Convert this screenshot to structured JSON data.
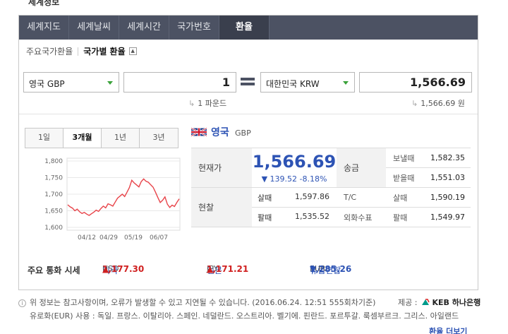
{
  "page": {
    "top_cut_title": "세계정보"
  },
  "tabs": [
    "세계지도",
    "세계날씨",
    "세계시간",
    "국가번호",
    "환율"
  ],
  "subnav": {
    "item1": "주요국가환율",
    "item2": "국가별 환율"
  },
  "converter": {
    "from_currency": "영국 GBP",
    "from_amount": "1",
    "to_currency": "대한민국 KRW",
    "to_amount": "1,566.69",
    "from_unit_text": "1 파운드",
    "to_unit_text": "1,566.69 원"
  },
  "period_tabs": [
    "1일",
    "3개월",
    "1년",
    "3년"
  ],
  "chart_data": {
    "type": "line",
    "x": [
      "04/12",
      "04/29",
      "05/19",
      "06/07"
    ],
    "series": [
      {
        "values": [
          1668,
          1662,
          1658,
          1650,
          1655,
          1647,
          1642,
          1645,
          1640,
          1636,
          1641,
          1646,
          1652,
          1648,
          1657,
          1664,
          1659,
          1671,
          1668,
          1664,
          1676,
          1688,
          1694,
          1700,
          1693,
          1706,
          1720,
          1742,
          1734,
          1728,
          1722,
          1738,
          1746,
          1739,
          1736,
          1728,
          1721,
          1706,
          1690,
          1675,
          1682,
          1692,
          1670,
          1660,
          1667,
          1663,
          1675,
          1686
        ]
      }
    ],
    "yticks": [
      "1,800",
      "1,750",
      "1,700",
      "1,650",
      "1,600"
    ],
    "ylim": [
      1600,
      1800
    ],
    "color": "#e8444a",
    "grid": true
  },
  "currency": {
    "name": "영국",
    "code": "GBP"
  },
  "rates": {
    "current_label": "현재가",
    "current_value": "1,566.69",
    "change_text": "▼ 139.52 -8.18%",
    "remit_label": "송금",
    "send_label": "보낼때",
    "send_value": "1,582.35",
    "receive_label": "받을때",
    "receive_value": "1,551.03",
    "cash_label": "현찰",
    "cash_buy_label": "살때",
    "cash_buy_value": "1,597.86",
    "cash_sell_label": "팔때",
    "cash_sell_value": "1,535.52",
    "tc_label": "T/C",
    "tc_buy_label": "살때",
    "tc_buy_value": "1,590.19",
    "check_label": "외화수표",
    "check_sell_label": "팔때",
    "check_sell_value": "1,549.97"
  },
  "major": {
    "label": "주요 통화 시세",
    "items": [
      {
        "name": "미국",
        "code": "USD",
        "value": "1,177.30",
        "dir": "▲"
      },
      {
        "name": "일본",
        "code": "JPY",
        "value": "1,171.21",
        "dir": "▲"
      },
      {
        "name": "유럽연합",
        "code": "EUR",
        "value": "1,285.26",
        "dir": "▼"
      }
    ]
  },
  "notice": {
    "line1": "위 정보는 참고사항이며, 오류가 발생할 수 있고 지연될 수 있습니다. (2016.06.24. 12:51 555회차기준)",
    "line2": "유로화(EUR) 사용 : 독일. 프랑스. 이탈리아. 스페인. 네덜란드. 오스트리아. 벨기에. 핀란드. 포르투갈. 룩셈부르크. 그리스. 아일랜드",
    "provider_label": "제공 :",
    "provider_name": "KEB 하나은행",
    "more_link": "환율 더보기"
  }
}
